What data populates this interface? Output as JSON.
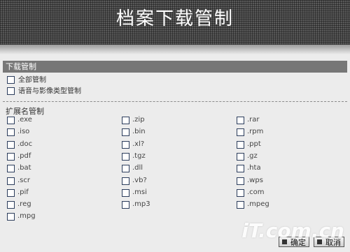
{
  "header": {
    "title": "档案下载管制"
  },
  "download_control": {
    "section_title": "下载管制",
    "options": [
      {
        "label": "全部管制"
      },
      {
        "label": "语音与影像类型管制"
      }
    ]
  },
  "extension_control": {
    "section_title": "扩展名管制",
    "columns": [
      [
        ".exe",
        ".iso",
        ".doc",
        ".pdf",
        ".bat",
        ".scr",
        ".pif",
        ".reg",
        ".mpg"
      ],
      [
        ".zip",
        ".bin",
        ".xl?",
        ".tgz",
        ".dll",
        ".vb?",
        ".msi",
        ".mp3"
      ],
      [
        ".rar",
        ".rpm",
        ".ppt",
        ".gz",
        ".hta",
        ".wps",
        ".com",
        ".mpeg"
      ]
    ]
  },
  "buttons": {
    "confirm": "确定",
    "cancel": "取消"
  },
  "watermark": "iT.com.cn"
}
